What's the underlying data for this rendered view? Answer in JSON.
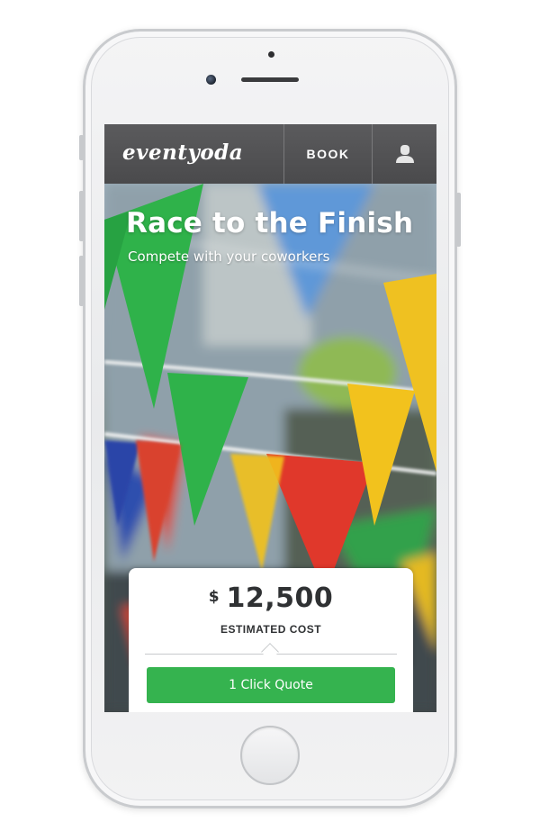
{
  "header": {
    "logo_text": "eventyoda",
    "book_label": "BOOK",
    "user_icon": "user-icon"
  },
  "hero": {
    "title": "Race to the Finish",
    "subtitle": "Compete with your coworkers"
  },
  "estimate": {
    "currency_symbol": "$",
    "amount": "12,500",
    "label": "ESTIMATED COST"
  },
  "cta": {
    "label": "1 Click Quote",
    "color": "#35b34f"
  },
  "colors": {
    "topbar": "#4f4f51",
    "flag_green": "#2fb24a",
    "flag_yellow": "#f2c21d",
    "flag_blue": "#4d8fd6",
    "flag_red": "#e0382b"
  }
}
